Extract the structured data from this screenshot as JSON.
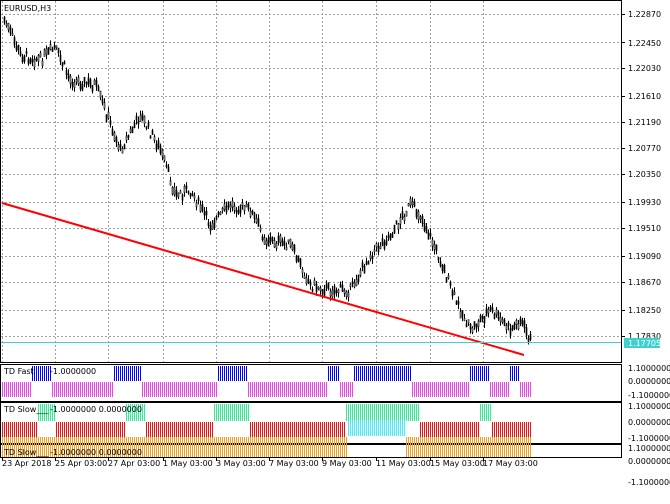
{
  "main_chart": {
    "title": "EURUSD,H3",
    "price_labels": [
      "1.22870",
      "1.22450",
      "1.22030",
      "1.21610",
      "1.21190",
      "1.20770",
      "1.20350",
      "1.19930",
      "1.19510",
      "1.19090",
      "1.18670",
      "1.18250",
      "1.17830"
    ],
    "current_price_label": "1.17705",
    "trendline_color": "#ff0000",
    "current_price_line_color": "#40d0d0"
  },
  "indicators": [
    {
      "name": "td-fast",
      "label": "TD Fast",
      "value_text": "-1.0000000",
      "scale_labels": [
        "1.1000000",
        "0.0000000",
        "-1.1000000"
      ],
      "colors": {
        "up": "#0000ff",
        "down": "#ee44ee"
      }
    },
    {
      "name": "td-slow-1",
      "label": "TD Slow___",
      "value_text": "-1.0000000 0.0000000",
      "scale_labels": [
        "1.1000000",
        "0.0000000",
        "-1.1000000"
      ],
      "colors": {
        "up": "#33ee99",
        "down": "#ee1111"
      }
    },
    {
      "name": "td-slow-2",
      "label": "TD Slow___",
      "value_text": "-1.0000000 0.0000000",
      "scale_labels": [
        "1.1000000",
        "0.0000000",
        "-1.1000000"
      ],
      "colors": {
        "up": "#44eeff",
        "down": "#f0a020"
      }
    }
  ],
  "time_labels": [
    "23 Apr 2018",
    "25 Apr 03:00",
    "27 Apr 03:00",
    "1 May 03:00",
    "3 May 03:00",
    "7 May 03:00",
    "9 May 03:00",
    "11 May 03:00",
    "15 May 03:00",
    "17 May 03:00"
  ]
}
